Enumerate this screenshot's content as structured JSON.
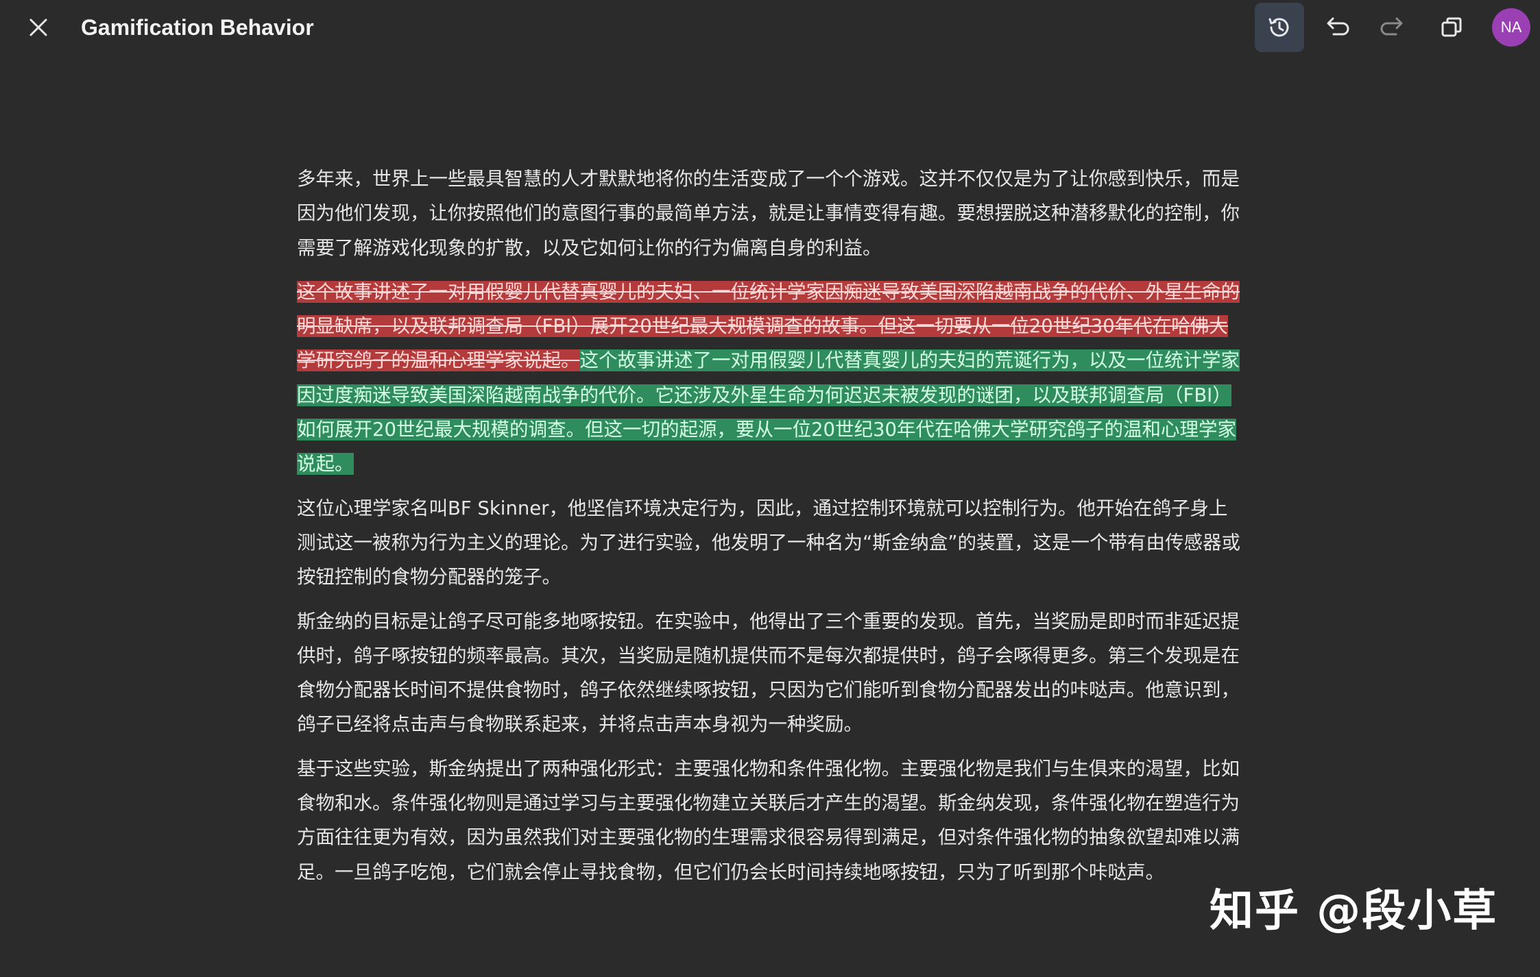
{
  "header": {
    "title": "Gamification Behavior",
    "avatar_initials": "NA"
  },
  "toolbar": {
    "icons": [
      "close-icon",
      "history-icon",
      "undo-icon",
      "redo-icon",
      "copy-icon"
    ]
  },
  "colors": {
    "background": "#2b2b2b",
    "deletion_highlight": "#b33b3b",
    "insertion_highlight": "#2f8c5d",
    "avatar": "#9b3fb5",
    "active_button": "#3a4250"
  },
  "document": {
    "p1": "多年来，世界上一些最具智慧的人才默默地将你的生活变成了一个个游戏。这并不仅仅是为了让你感到快乐，而是因为他们发现，让你按照他们的意图行事的最简单方法，就是让事情变得有趣。要想摆脱这种潜移默化的控制，你需要了解游戏化现象的扩散，以及它如何让你的行为偏离自身的利益。",
    "p2_deleted": "这个故事讲述了一对用假婴儿代替真婴儿的夫妇、一位统计学家因痴迷导致美国深陷越南战争的代价、外星生命的明显缺席，以及联邦调查局（FBI）展开20世纪最大规模调查的故事。但这一切要从一位20世纪30年代在哈佛大学研究鸽子的温和心理学家说起。",
    "p2_inserted": "这个故事讲述了一对用假婴儿代替真婴儿的夫妇的荒诞行为，以及一位统计学家因过度痴迷导致美国深陷越南战争的代价。它还涉及外星生命为何迟迟未被发现的谜团，以及联邦调查局（FBI）如何展开20世纪最大规模的调查。但这一切的起源，要从一位20世纪30年代在哈佛大学研究鸽子的温和心理学家说起。",
    "p3": "这位心理学家名叫BF Skinner，他坚信环境决定行为，因此，通过控制环境就可以控制行为。他开始在鸽子身上测试这一被称为行为主义的理论。为了进行实验，他发明了一种名为“斯金纳盒”的装置，这是一个带有由传感器或按钮控制的食物分配器的笼子。",
    "p4": "斯金纳的目标是让鸽子尽可能多地啄按钮。在实验中，他得出了三个重要的发现。首先，当奖励是即时而非延迟提供时，鸽子啄按钮的频率最高。其次，当奖励是随机提供而不是每次都提供时，鸽子会啄得更多。第三个发现是在食物分配器长时间不提供食物时，鸽子依然继续啄按钮，只因为它们能听到食物分配器发出的咔哒声。他意识到，鸽子已经将点击声与食物联系起来，并将点击声本身视为一种奖励。",
    "p5": "基于这些实验，斯金纳提出了两种强化形式：主要强化物和条件强化物。主要强化物是我们与生俱来的渴望，比如食物和水。条件强化物则是通过学习与主要强化物建立关联后才产生的渴望。斯金纳发现，条件强化物在塑造行为方面往往更为有效，因为虽然我们对主要强化物的生理需求很容易得到满足，但对条件强化物的抽象欲望却难以满足。一旦鸽子吃饱，它们就会停止寻找食物，但它们仍会长时间持续地啄按钮，只为了听到那个咔哒声。"
  },
  "watermark": "知乎 @段小草"
}
